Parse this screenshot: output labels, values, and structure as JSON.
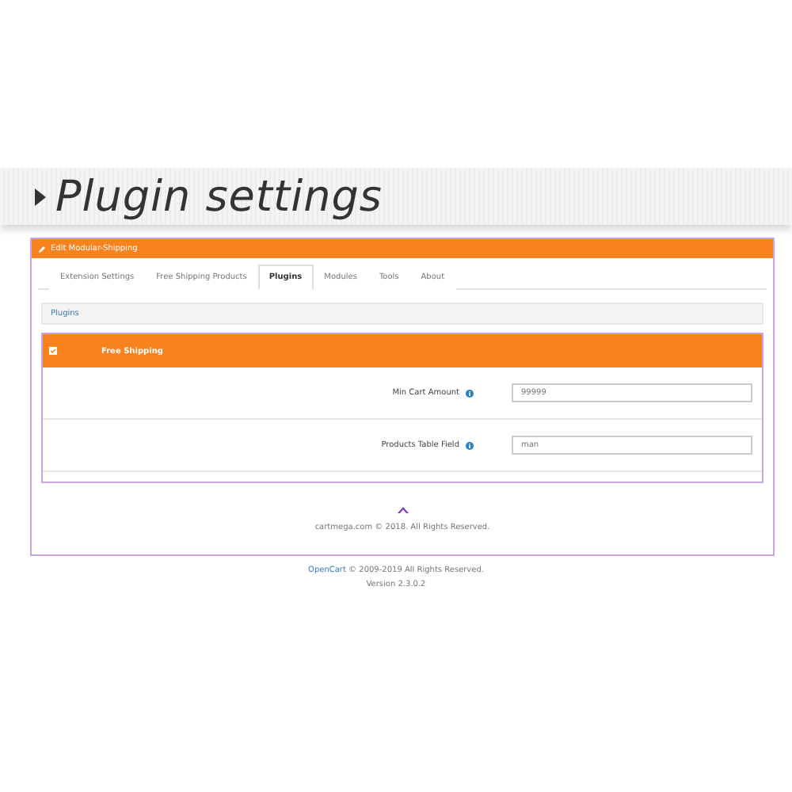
{
  "banner": {
    "title": "Plugin settings"
  },
  "card": {
    "title": "Edit Modular-Shipping",
    "tabs": [
      {
        "label": "Extension Settings",
        "selected": false
      },
      {
        "label": "Free Shipping Products",
        "selected": false
      },
      {
        "label": "Plugins",
        "selected": true
      },
      {
        "label": "Modules",
        "selected": false
      },
      {
        "label": "Tools",
        "selected": false
      },
      {
        "label": "About",
        "selected": false
      }
    ],
    "breadcrumb": "Plugins",
    "panel": {
      "title": "Free Shipping",
      "fields": [
        {
          "label": "Min Cart Amount",
          "value": "99999"
        },
        {
          "label": "Products Table Field",
          "value": "man"
        }
      ]
    },
    "footer": "cartmega.com © 2018. All Rights Reserved."
  },
  "page_footer": {
    "link": "OpenCart",
    "text": " © 2009-2019 All Rights Reserved.",
    "version": "Version 2.3.0.2"
  }
}
